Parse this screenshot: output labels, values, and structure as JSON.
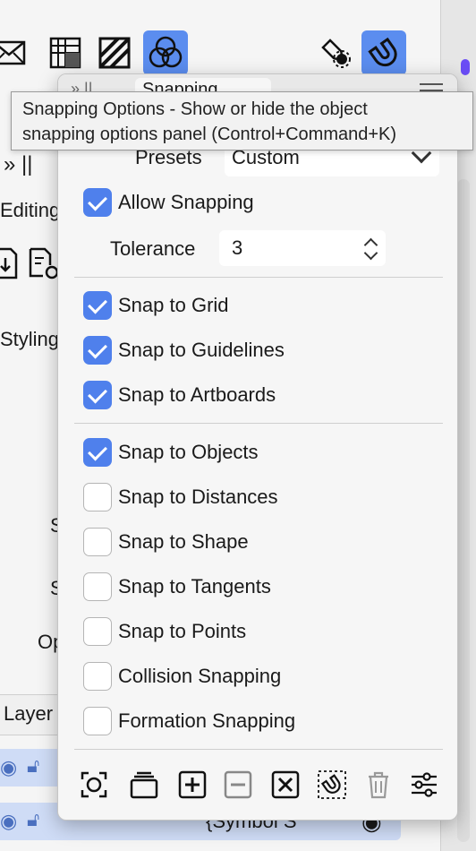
{
  "tooltip": {
    "line1": "Snapping Options - Show or hide the object",
    "line2": "snapping options panel (Control+Command+K)"
  },
  "panel": {
    "tab_label": "Snapping",
    "presets_label": "Presets",
    "presets_value": "Custom",
    "tolerance_label": "Tolerance",
    "tolerance_value": "3",
    "options": [
      {
        "label": "Allow Snapping",
        "checked": true
      },
      {
        "label": "Snap to Grid",
        "checked": true
      },
      {
        "label": "Snap to Guidelines",
        "checked": true
      },
      {
        "label": "Snap to Artboards",
        "checked": true
      },
      {
        "label": "Snap to Objects",
        "checked": true
      },
      {
        "label": "Snap to Distances",
        "checked": false
      },
      {
        "label": "Snap to Shape",
        "checked": false
      },
      {
        "label": "Snap to Tangents",
        "checked": false
      },
      {
        "label": "Snap to Points",
        "checked": false
      },
      {
        "label": "Collision Snapping",
        "checked": false
      },
      {
        "label": "Formation Snapping",
        "checked": false
      }
    ],
    "bottom_icons": [
      "capture-icon",
      "stack-icon",
      "add-icon",
      "remove-icon",
      "delete-x-icon",
      "magnet-select-icon",
      "trash-icon",
      "sliders-icon"
    ]
  },
  "background": {
    "left_fragments": [
      "Editing",
      "Styling",
      "S",
      "S",
      "Op",
      "Layer"
    ],
    "layer_row_text": "{Symbol S"
  },
  "colors": {
    "accent": "#4f80ec",
    "toolbar_active": "#5b8def",
    "layer_row": "#cfdcf6"
  }
}
